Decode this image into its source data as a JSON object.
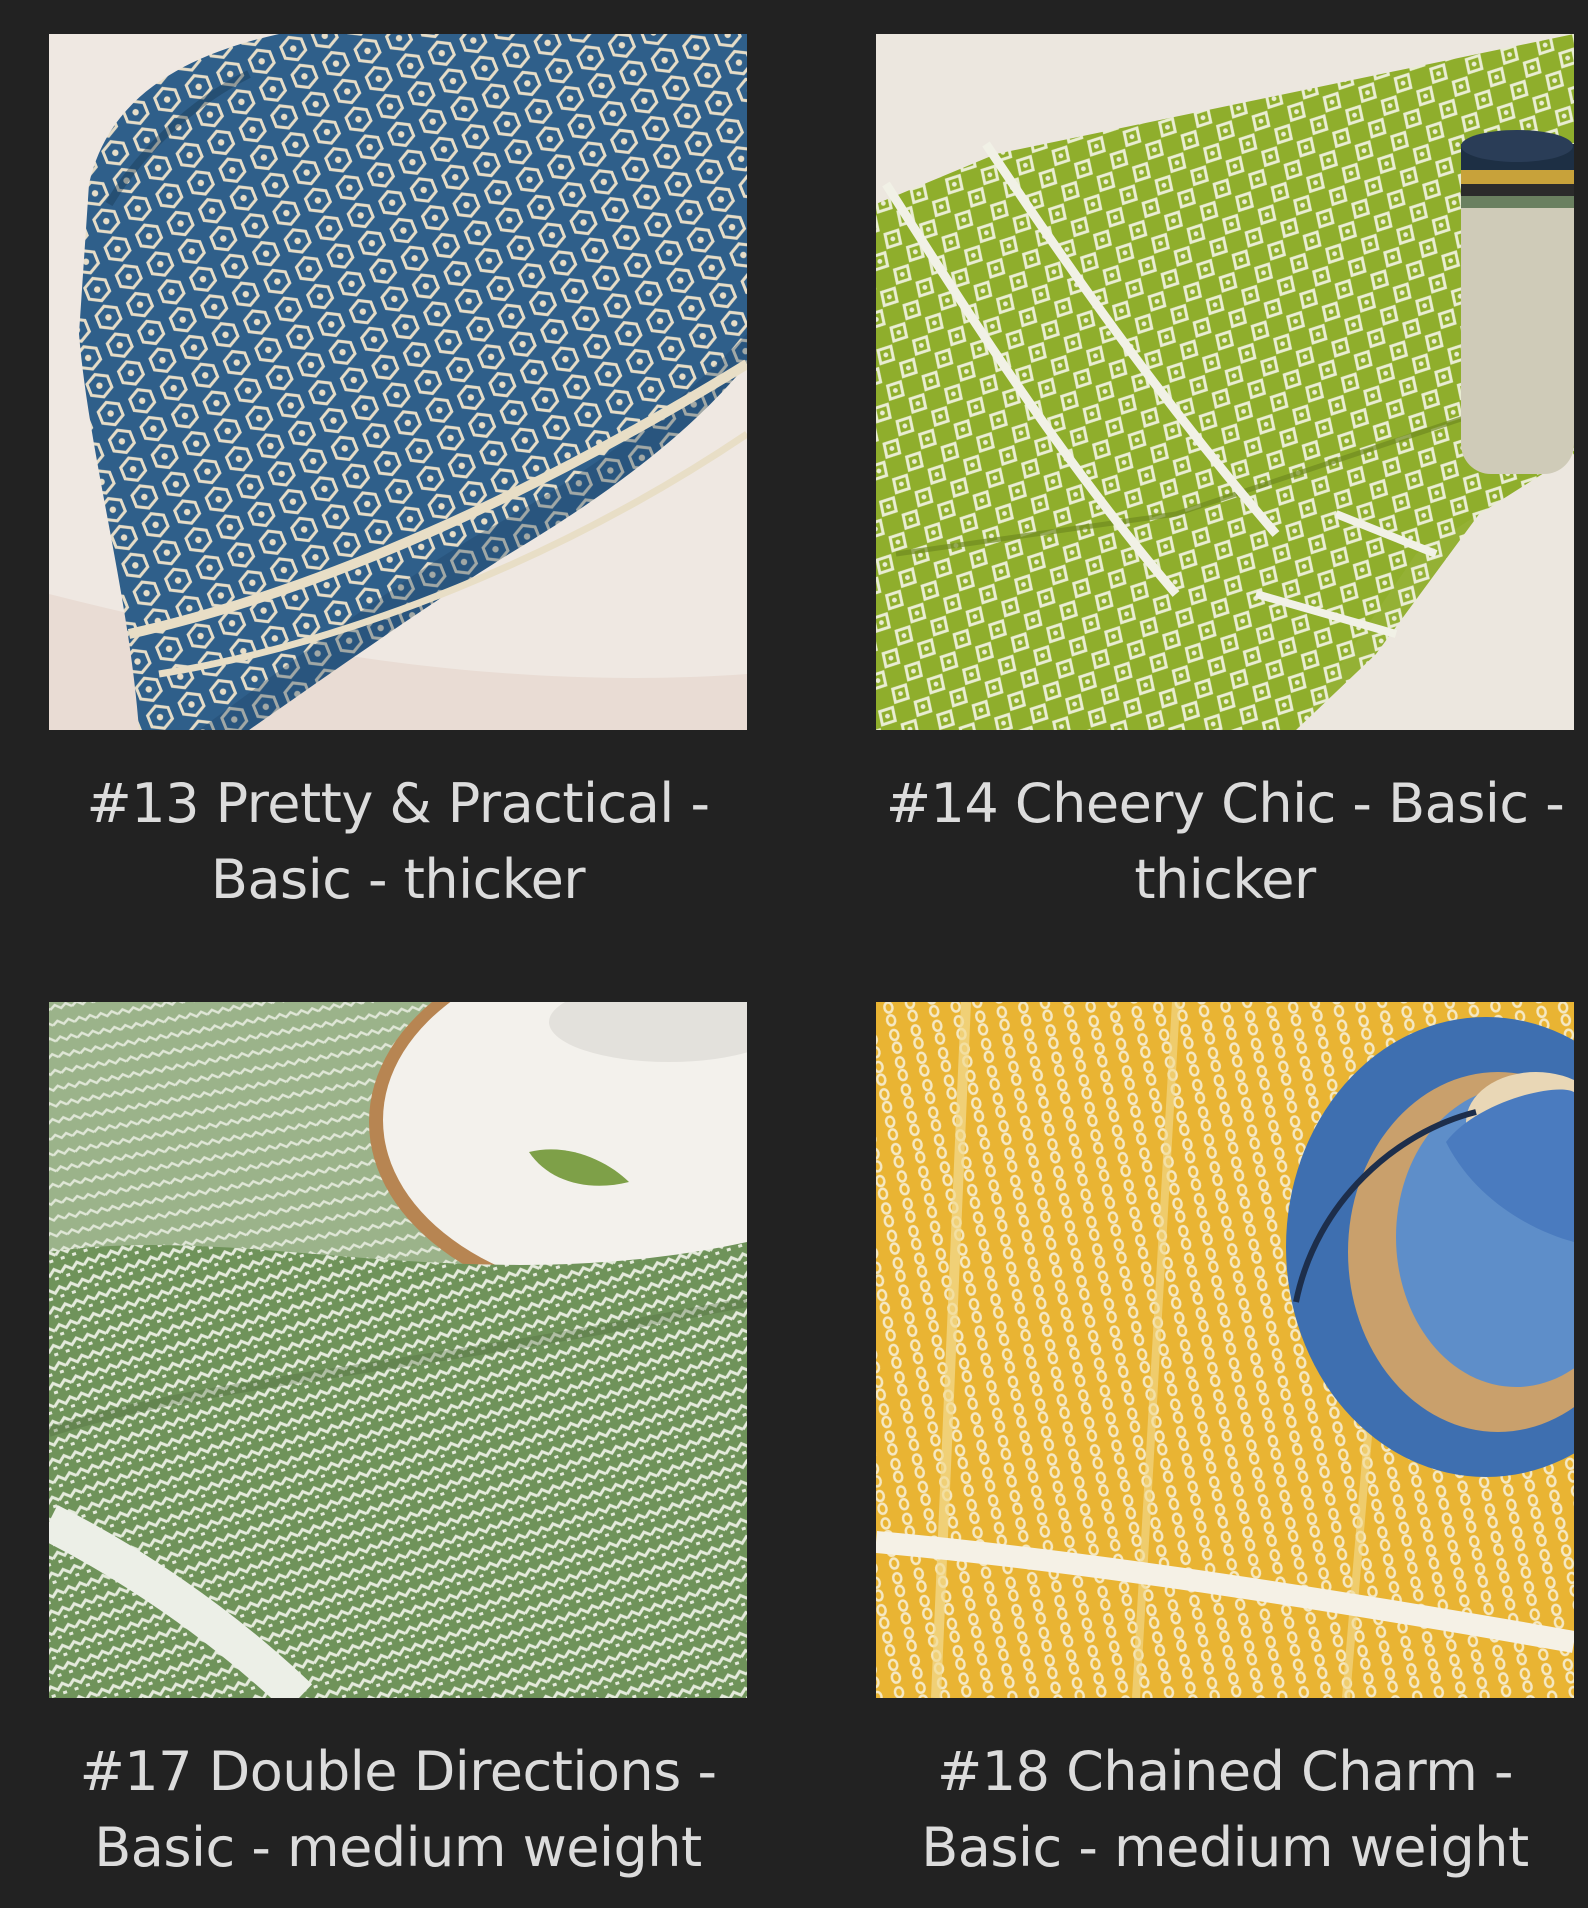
{
  "products": [
    {
      "caption": "#13 Pretty & Practical - Basic - thicker",
      "image": "blue honeycomb woven towel",
      "color": "#2f5f8a"
    },
    {
      "caption": "#14 Cheery Chic - Basic - thicker",
      "image": "lime green woven towel with mug",
      "color": "#8fae2c"
    },
    {
      "caption": "#17 Double Directions - Basic - medium weight",
      "image": "sage green woven towel with bowl",
      "color": "#6f935a"
    },
    {
      "caption": "#18 Chained Charm - Basic - medium weight",
      "image": "yellow woven towel with blue cup",
      "color": "#e9b433"
    }
  ],
  "colors": {
    "background": "#222222",
    "caption_text": "#dcdcdc"
  }
}
